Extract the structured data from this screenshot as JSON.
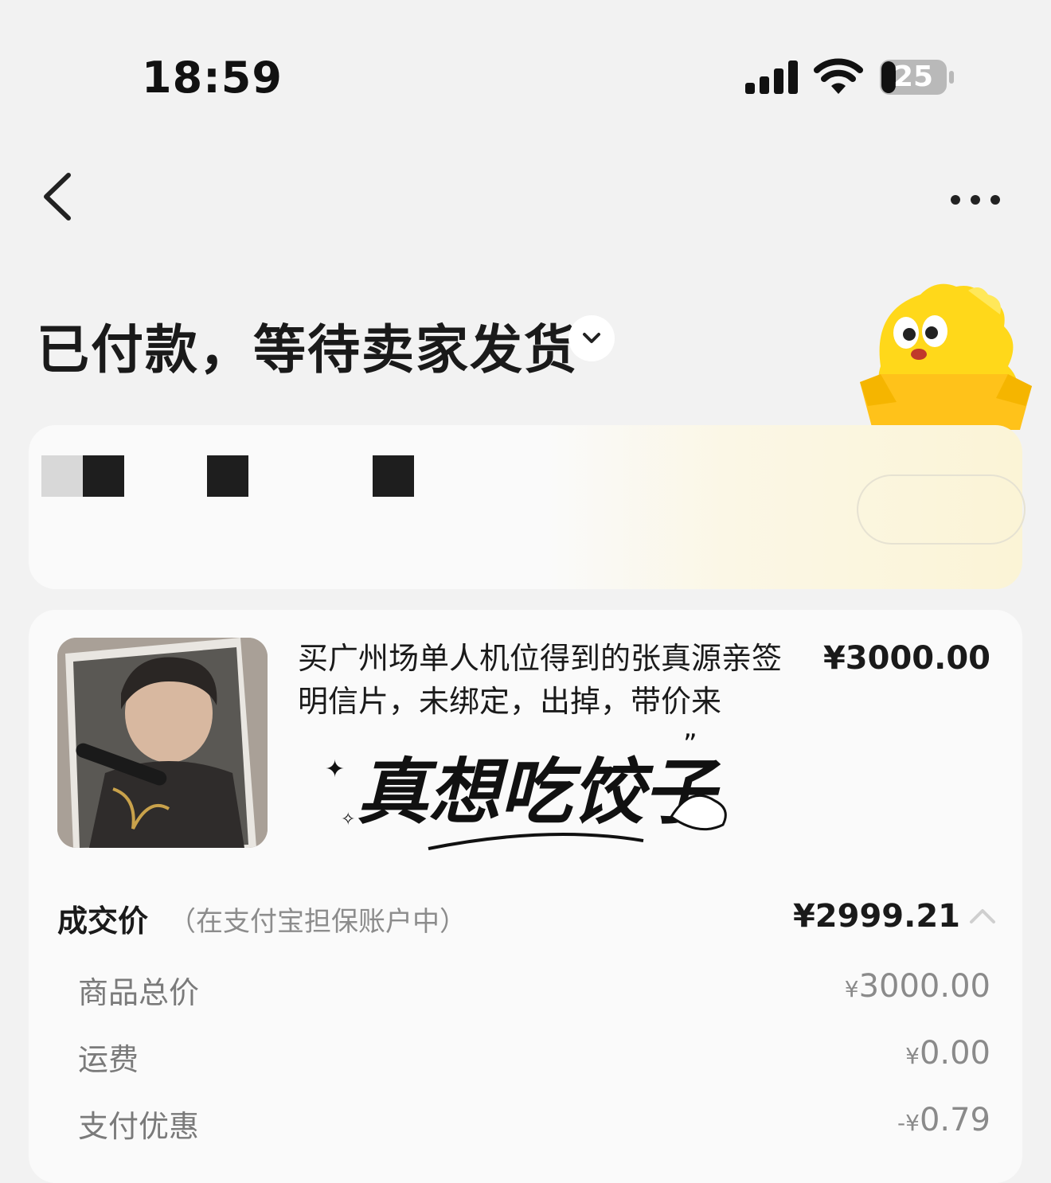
{
  "status_bar": {
    "time": "18:59",
    "battery": "25"
  },
  "header": {
    "back_icon": "chevron-left-icon",
    "more_icon": "more-horizontal-icon"
  },
  "order_status": {
    "title": "已付款，等待卖家发货"
  },
  "product": {
    "title": "买广州场单人机位得到的张真源亲签明信片，未绑定，出掉，带价来",
    "price": "¥3000.00",
    "calligraphy_text": "真想吃饺子"
  },
  "deal": {
    "label": "成交价",
    "note": "（在支付宝担保账户中）",
    "value": "¥2999.21"
  },
  "breakdown": [
    {
      "label": "商品总价",
      "symbol": "¥",
      "amount": "3000.00"
    },
    {
      "label": "运费",
      "symbol": "¥",
      "amount": "0.00"
    },
    {
      "label": "支付优惠",
      "symbol": "-¥",
      "amount": "0.79"
    }
  ]
}
